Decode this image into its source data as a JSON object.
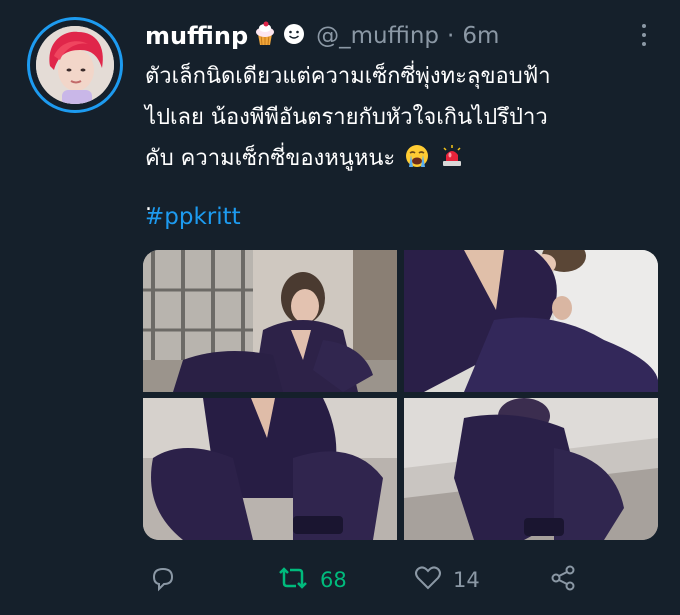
{
  "tweet": {
    "display_name": "muffinp",
    "handle": "@_muffinp",
    "separator": "·",
    "time": "6m",
    "name_emojis": [
      "cupcake-emoji",
      "smile-emoji"
    ],
    "text_lines": [
      "ตัวเล็กนิดเดียวแต่ความเซ็กซี่พุ่งทะลุขอบฟ้า",
      "ไปเลย น้องพีพีอันตรายกับหัวใจเกินไปรึป่าว",
      "คับ ความเซ็กซี่ของหนูหนะ",
      "."
    ],
    "text_emojis": [
      "crying-face-emoji",
      "police-light-emoji"
    ],
    "hashtag": "#ppkritt",
    "media_count": 4
  },
  "actions": {
    "reply": {
      "icon": "reply-icon",
      "count": ""
    },
    "retweet": {
      "icon": "retweet-icon",
      "count": "68"
    },
    "like": {
      "icon": "heart-icon",
      "count": "14"
    },
    "share": {
      "icon": "share-icon",
      "count": ""
    }
  },
  "colors": {
    "background": "#15202b",
    "text": "#ffffff",
    "secondary": "#8b98a5",
    "link": "#1d9bf0",
    "retweet_active": "#00ba7c",
    "avatar_ring": "#1d9bf0"
  }
}
